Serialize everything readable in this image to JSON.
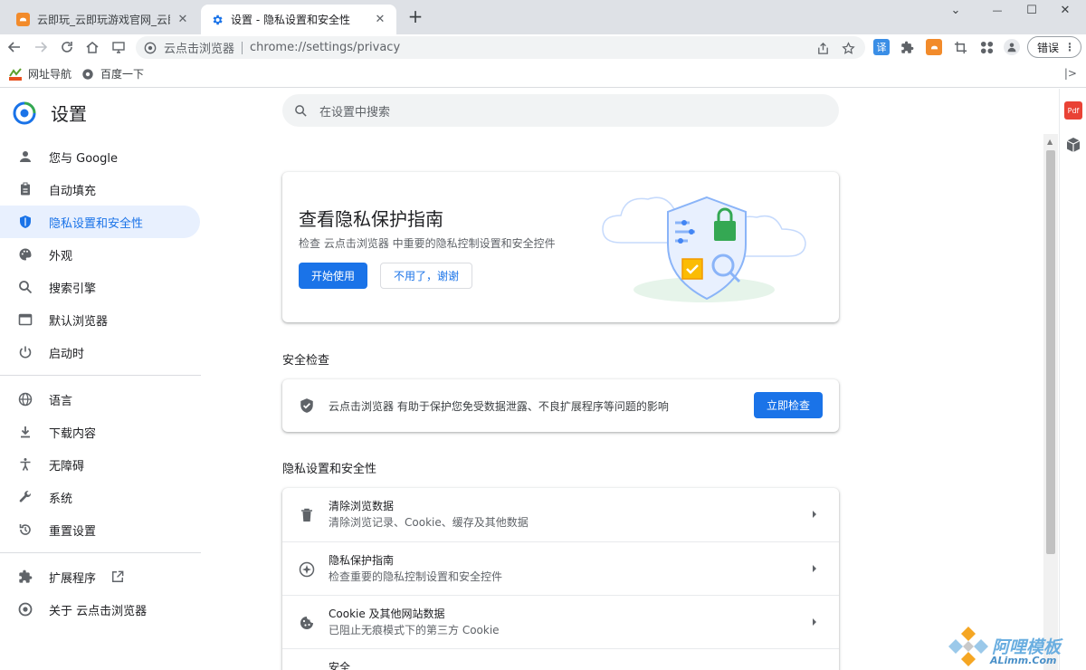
{
  "tabs": [
    {
      "title": "云即玩_云即玩游戏官网_云即玩游",
      "close": "✕"
    },
    {
      "title": "设置 - 隐私设置和安全性",
      "close": "✕"
    }
  ],
  "new_tab": "+",
  "window_controls": {
    "minimize": "—",
    "maximize": "☐",
    "close": "✕",
    "tab_search": "⌄"
  },
  "toolbar": {
    "site_name": "云点击浏览器",
    "url": "chrome://settings/privacy",
    "translate_ext": "译",
    "profile_label": "错误",
    "menu": "⋮"
  },
  "bookmarks": [
    {
      "label": "网址导航",
      "icon": "hao-icon"
    },
    {
      "label": "百度一下",
      "icon": "globe-icon"
    }
  ],
  "bookmarks_right": "|>",
  "settings": {
    "title": "设置",
    "search_placeholder": "在设置中搜索",
    "nav": [
      {
        "label": "您与 Google",
        "icon": "person-icon"
      },
      {
        "label": "自动填充",
        "icon": "clipboard-icon"
      },
      {
        "label": "隐私设置和安全性",
        "icon": "shield-icon",
        "active": true
      },
      {
        "label": "外观",
        "icon": "palette-icon"
      },
      {
        "label": "搜索引擎",
        "icon": "search-icon"
      },
      {
        "label": "默认浏览器",
        "icon": "browser-icon"
      },
      {
        "label": "启动时",
        "icon": "power-icon"
      },
      {
        "label": "语言",
        "icon": "globe-icon"
      },
      {
        "label": "下载内容",
        "icon": "download-icon"
      },
      {
        "label": "无障碍",
        "icon": "accessibility-icon"
      },
      {
        "label": "系统",
        "icon": "wrench-icon"
      },
      {
        "label": "重置设置",
        "icon": "reset-icon"
      },
      {
        "label": "扩展程序",
        "icon": "puzzle-icon"
      },
      {
        "label": "关于 云点击浏览器",
        "icon": "browser-logo-icon"
      }
    ],
    "promo": {
      "title": "查看隐私保护指南",
      "subtitle": "检查 云点击浏览器 中重要的隐私控制设置和安全控件",
      "primary": "开始使用",
      "secondary": "不用了，谢谢"
    },
    "safety": {
      "section_title": "安全检查",
      "text": "云点击浏览器 有助于保护您免受数据泄露、不良扩展程序等问题的影响",
      "button": "立即检查"
    },
    "privacy": {
      "section_title": "隐私设置和安全性",
      "rows": [
        {
          "title": "清除浏览数据",
          "subtitle": "清除浏览记录、Cookie、缓存及其他数据",
          "icon": "trash-icon"
        },
        {
          "title": "隐私保护指南",
          "subtitle": "检查重要的隐私控制设置和安全控件",
          "icon": "compass-icon"
        },
        {
          "title": "Cookie 及其他网站数据",
          "subtitle": "已阻止无痕模式下的第三方 Cookie",
          "icon": "cookie-icon"
        },
        {
          "title": "安全",
          "subtitle": "",
          "icon": "shield-icon"
        }
      ]
    }
  },
  "side_panel": {
    "pdf_label": "Pdf"
  },
  "watermark": {
    "line1": "阿哩模板",
    "line2": "ALimm.Com"
  },
  "colors": {
    "accent": "#1a73e8",
    "nav_active_bg": "#e8f0fe",
    "tabstrip": "#dee1e6"
  }
}
